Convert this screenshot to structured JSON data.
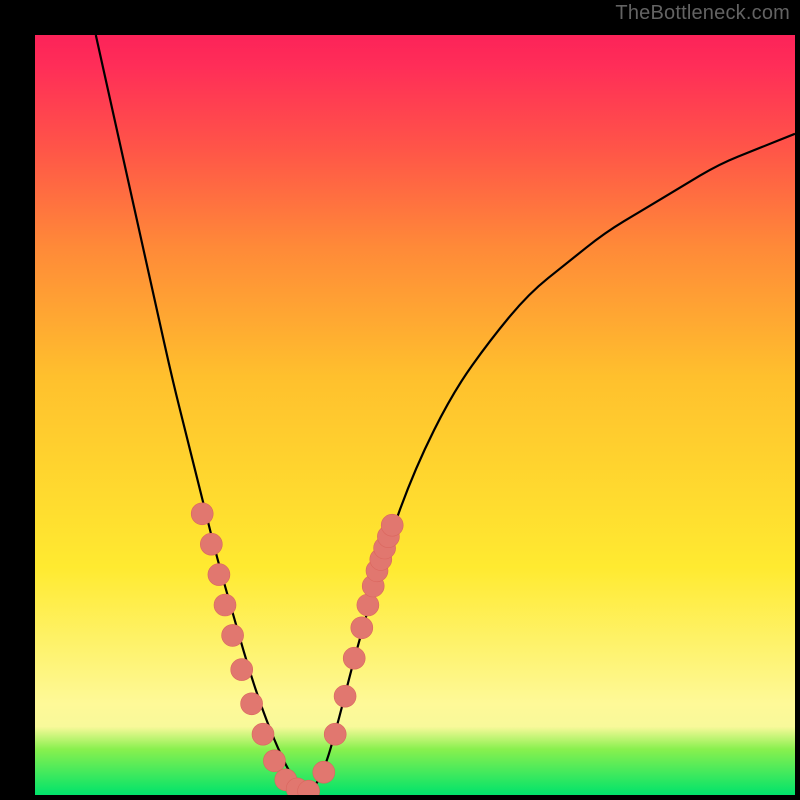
{
  "watermark": "TheBottleneck.com",
  "chart_data": {
    "type": "line",
    "title": "",
    "xlabel": "",
    "ylabel": "",
    "xlim": [
      0,
      100
    ],
    "ylim": [
      0,
      100
    ],
    "grid": false,
    "series": [
      {
        "name": "bottleneck-curve",
        "x": [
          8,
          10,
          12,
          14,
          16,
          18,
          20,
          22,
          24,
          26,
          28,
          30,
          32,
          34,
          36,
          38,
          40,
          42,
          46,
          50,
          55,
          60,
          65,
          70,
          75,
          80,
          85,
          90,
          95,
          100
        ],
        "values": [
          100,
          91,
          82,
          73,
          64,
          55,
          47,
          39,
          31,
          24,
          17,
          11,
          6,
          2,
          0,
          3,
          10,
          18,
          32,
          43,
          53,
          60,
          66,
          70,
          74,
          77,
          80,
          83,
          85,
          87
        ]
      }
    ],
    "markers": {
      "name": "data-points",
      "x": [
        22,
        23.2,
        24.2,
        25,
        26,
        27.2,
        28.5,
        30,
        31.5,
        33,
        34.5,
        36,
        38,
        39.5,
        40.8,
        42,
        43,
        43.8,
        44.5,
        45,
        45.5,
        46,
        46.5,
        47
      ],
      "values": [
        37,
        33,
        29,
        25,
        21,
        16.5,
        12,
        8,
        4.5,
        2,
        0.8,
        0.5,
        3,
        8,
        13,
        18,
        22,
        25,
        27.5,
        29.5,
        31,
        32.5,
        34,
        35.5
      ],
      "radius": 11
    },
    "background_gradient": {
      "stops": [
        {
          "pos": 0,
          "color": "#fc2359"
        },
        {
          "pos": 15,
          "color": "#ff5548"
        },
        {
          "pos": 28,
          "color": "#ff8a38"
        },
        {
          "pos": 45,
          "color": "#ffc02d"
        },
        {
          "pos": 70,
          "color": "#ffea30"
        },
        {
          "pos": 88,
          "color": "#fef998"
        },
        {
          "pos": 91,
          "color": "#f8f99a"
        },
        {
          "pos": 94,
          "color": "#88f04e"
        },
        {
          "pos": 100,
          "color": "#00e36b"
        }
      ]
    }
  }
}
